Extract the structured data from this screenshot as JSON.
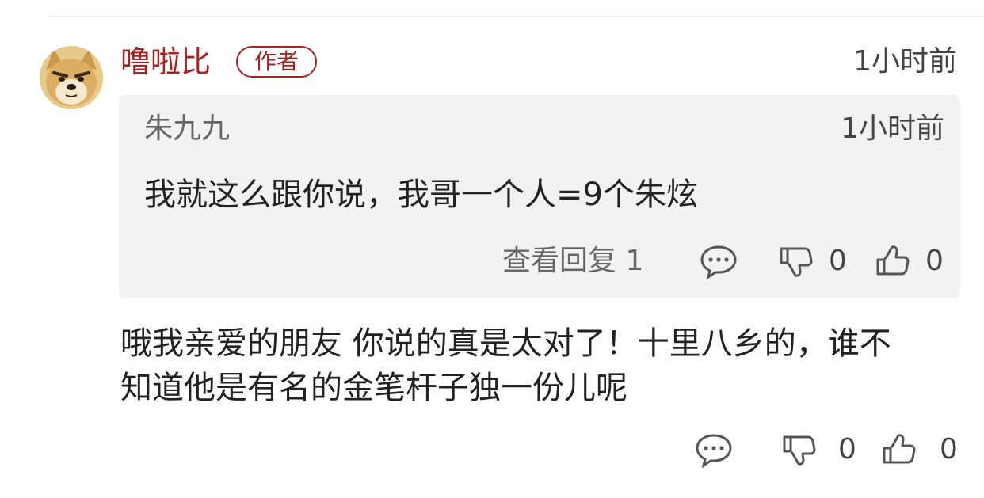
{
  "comment": {
    "username": "噜啦比",
    "badge": "作者",
    "time": "1小时前",
    "body": "哦我亲爱的朋友 你说的真是太对了！十里八乡的，谁不知道他是有名的金笔杆子独一份儿呢",
    "dislike_count": "0",
    "like_count": "0"
  },
  "quoted": {
    "username": "朱九九",
    "time": "1小时前",
    "text": "我就这么跟你说，我哥一个人=9个朱炫",
    "view_replies_label": "查看回复 1",
    "dislike_count": "0",
    "like_count": "0"
  },
  "colors": {
    "username": "#a52323",
    "quote_bg": "#f2f2f2",
    "text": "#222222",
    "muted": "#666666"
  },
  "icons": [
    "avatar-doge",
    "comment-bubble-icon",
    "thumbs-down-icon",
    "thumbs-up-icon"
  ]
}
